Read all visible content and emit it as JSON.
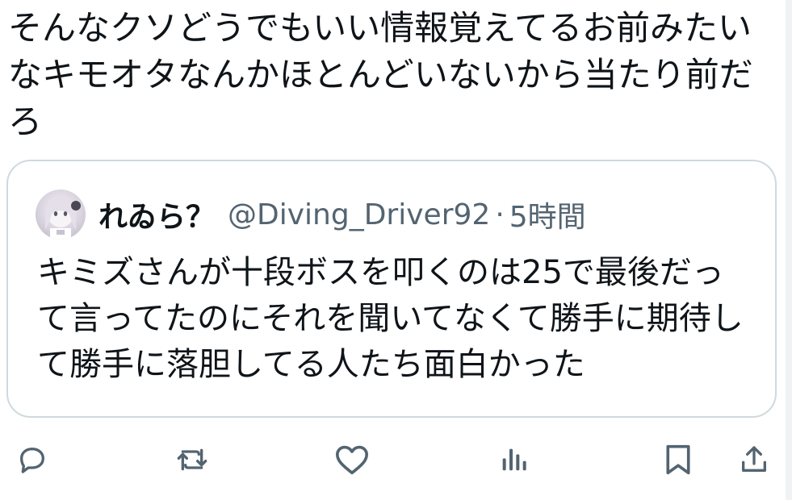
{
  "post": {
    "text": "そんなクソどうでもいい情報覚えてるお前みたいなキモオタなんかほとんどいないから当たり前だろ"
  },
  "quote": {
    "author_name": "れゐら？",
    "handle": "@Diving_Driver92",
    "separator": "·",
    "time": "5時間",
    "text": "キミズさんが十段ボスを叩くのは25で最後だって言ってたのにそれを聞いてなくて勝手に期待して勝手に落胆してる人たち面白かった"
  },
  "actions": [
    {
      "icon": "reply-icon"
    },
    {
      "icon": "repost-icon"
    },
    {
      "icon": "like-icon"
    },
    {
      "icon": "views-icon"
    },
    {
      "icon": "bookmark-icon"
    },
    {
      "icon": "share-icon"
    }
  ],
  "colors": {
    "text_primary": "#0f1419",
    "text_secondary": "#536471",
    "border": "#cfd9de"
  }
}
